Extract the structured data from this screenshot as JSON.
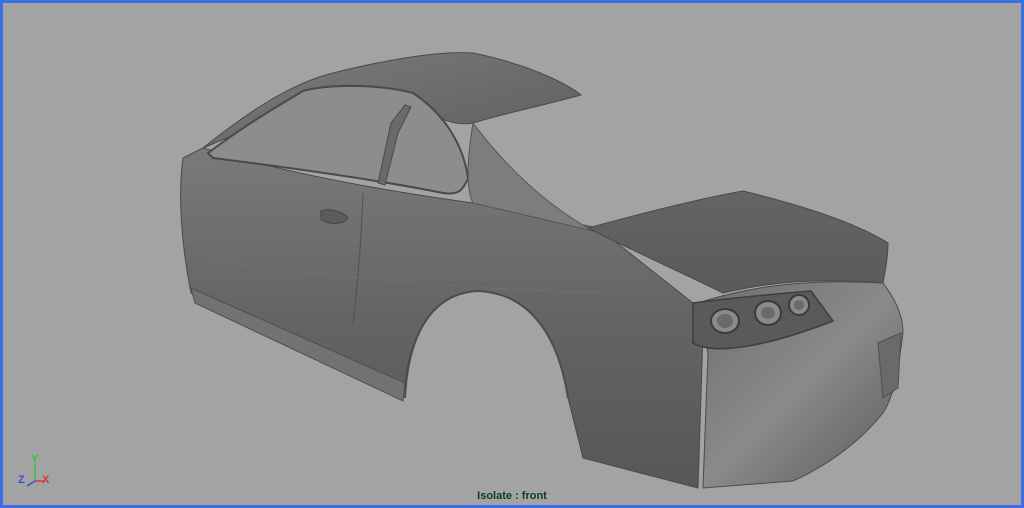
{
  "viewport": {
    "border_color": "#3e6fe6",
    "background_color": "#a3a3a3",
    "status_text": "Isolate : front"
  },
  "axis_indicator": {
    "y_label": "Y",
    "z_label": "Z",
    "x_label": "X",
    "y_color": "#3bbf3b",
    "z_color": "#3a4ed8",
    "x_color": "#d33a3a"
  },
  "model": {
    "icon": "car-body-shell",
    "shade_color": "#6a6a6a"
  }
}
